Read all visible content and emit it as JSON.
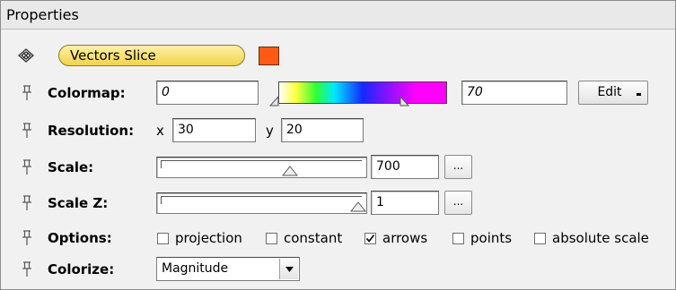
{
  "panel": {
    "title": "Properties"
  },
  "object": {
    "name": "Vectors Slice",
    "color": "#ff5a14"
  },
  "colormap": {
    "label": "Colormap:",
    "min_value": "0",
    "max_value": "70",
    "edit_label": "Edit",
    "lower_marker_level": 0.0,
    "upper_marker_level": 0.72
  },
  "resolution": {
    "label": "Resolution:",
    "x_label": "x",
    "x_value": "30",
    "y_label": "y",
    "y_value": "20"
  },
  "scale": {
    "label": "Scale:",
    "value": "700",
    "slider_level": 0.64,
    "browse_label": "..."
  },
  "scale_z": {
    "label": "Scale Z:",
    "value": "1",
    "slider_level": 1.0,
    "browse_label": "..."
  },
  "options": {
    "label": "Options:",
    "items": [
      {
        "label": "projection",
        "checked": false
      },
      {
        "label": "constant",
        "checked": false
      },
      {
        "label": "arrows",
        "checked": true
      },
      {
        "label": "points",
        "checked": false
      },
      {
        "label": "absolute scale",
        "checked": false
      }
    ]
  },
  "colorize": {
    "label": "Colorize:",
    "selected": "Magnitude"
  },
  "icons": {
    "object_icon": "vectors-icon",
    "pin_icon": "pin-icon",
    "dropdown_icon": "chevron-down-icon"
  }
}
